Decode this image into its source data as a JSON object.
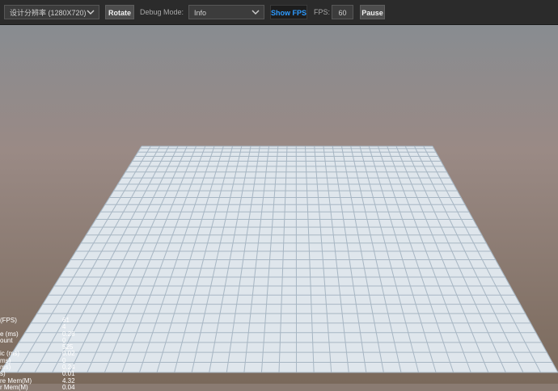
{
  "toolbar": {
    "resolution_select": "设计分辨率 (1280X720)",
    "rotate_label": "Rotate",
    "debug_mode_label": "Debug Mode:",
    "debug_mode_value": "Info",
    "show_fps_label": "Show FPS",
    "fps_label": "FPS:",
    "fps_value": "60",
    "pause_label": "Pause"
  },
  "stats": [
    {
      "label": "(FPS)",
      "value": "61"
    },
    {
      "label": "",
      "value": "4"
    },
    {
      "label": "e (ms)",
      "value": "0.28"
    },
    {
      "label": "ount",
      "value": "0"
    },
    {
      "label": "",
      "value": "525"
    },
    {
      "label": "ic (ms)",
      "value": "0.02"
    },
    {
      "label": "ms)",
      "value": "0"
    },
    {
      "label": "ms)",
      "value": "0.24"
    },
    {
      "label": "s)",
      "value": "0.01"
    },
    {
      "label": "re Mem(M)",
      "value": "4.32"
    },
    {
      "label": "r Mem(M)",
      "value": "0.04"
    }
  ]
}
